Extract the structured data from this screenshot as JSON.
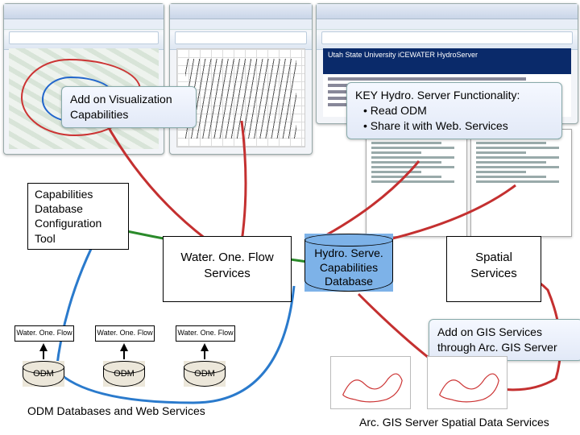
{
  "callouts": {
    "addon_viz": "Add on Visualization Capabilities",
    "key_title": "KEY Hydro. Server Functionality:",
    "key_b1": "Read ODM",
    "key_b2": "Share it with Web. Services",
    "addon_gis_l1": "Add on GIS Services",
    "addon_gis_l2": "through Arc. GIS Server"
  },
  "boxes": {
    "caps_db_tool_l1": "Capabilities",
    "caps_db_tool_l2": "Database",
    "caps_db_tool_l3": "Configuration",
    "caps_db_tool_l4": "Tool",
    "wof_services_l1": "Water. One. Flow",
    "wof_services_l2": "Services",
    "spatial_l1": "Spatial",
    "spatial_l2": "Services",
    "hydro_caps_l1": "Hydro. Serve.",
    "hydro_caps_l2": "Capabilities",
    "hydro_caps_l3": "Database"
  },
  "labels": {
    "wof_small": "Water. One. Flow",
    "odm": "ODM"
  },
  "captions": {
    "odm_db_ws": "ODM Databases and Web Services",
    "arcgis_spatial": "Arc. GIS Server Spatial Data Services"
  },
  "banner_text": "Utah State University iCEWATER HydroServer"
}
